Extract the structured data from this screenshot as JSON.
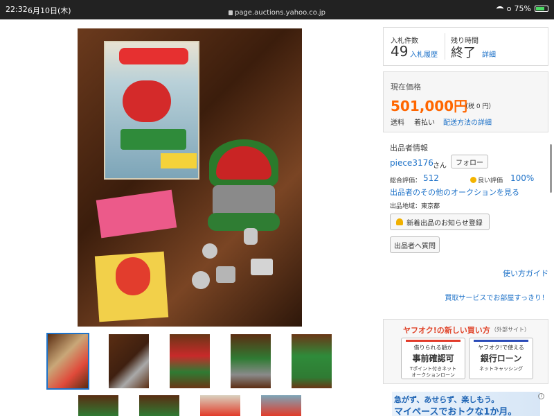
{
  "status_bar": {
    "time": "22:32",
    "date": "6月10日(木)",
    "url": "page.auctions.yahoo.co.jp",
    "battery": "75%",
    "battery_fraction": 0.75
  },
  "main_image": {
    "alt": ""
  },
  "thumbnails": [
    {
      "name": "thumb-1",
      "selected": true
    },
    {
      "name": "thumb-2",
      "selected": false
    },
    {
      "name": "thumb-3",
      "selected": false
    },
    {
      "name": "thumb-4",
      "selected": false
    },
    {
      "name": "thumb-5",
      "selected": false
    },
    {
      "name": "thumb-6",
      "selected": false
    },
    {
      "name": "thumb-7",
      "selected": false
    },
    {
      "name": "thumb-8",
      "selected": false
    },
    {
      "name": "thumb-9",
      "selected": false
    }
  ],
  "bids": {
    "label": "入札件数",
    "count": "49",
    "history_link": "入札履歴"
  },
  "remaining": {
    "label": "残り時間",
    "value": "終了",
    "detail_link": "詳細"
  },
  "price": {
    "label": "現在価格",
    "value": "501,000円",
    "tax": "（税 0 円）"
  },
  "shipping": {
    "label": "送料",
    "payment": "着払い",
    "detail_link": "配送方法の詳細"
  },
  "seller": {
    "title": "出品者情報",
    "name": "piece3176",
    "suffix": "さん",
    "follow_button": "フォロー",
    "rating_label": "総合評価：",
    "rating_value": "512",
    "good_label": "良い評価",
    "good_value": "100%",
    "other_auctions_link": "出品者のその他のオークションを見る",
    "region": "出品地域：東京都",
    "notify_button": "新着出品のお知らせ登録",
    "ask_button": "出品者へ質問"
  },
  "links": {
    "guide": "使い方ガイド",
    "buyback": "買取サービスでお部屋すっきり！"
  },
  "new_buy": {
    "title": "ヤフオク!の新しい買い方",
    "external": "（外部サイト）",
    "buttons": [
      {
        "sub": "借りられる額が",
        "main": "事前確認可",
        "foot1": "Tポイント付きネット",
        "foot2": "オークションローン",
        "color": "#e23b2a"
      },
      {
        "sub": "ヤフオク!で使える",
        "main": "銀行ローン",
        "foot1": "ネットキャッシング",
        "foot2": "",
        "color": "#2b4bb8"
      }
    ]
  },
  "ad": {
    "line1": "急がず、あせらず、楽しもう。",
    "line2": "マイペースでおトクな1か月。",
    "info_icon": "i"
  },
  "colors": {
    "accent": "#1e72c8",
    "price": "#ff6600"
  }
}
